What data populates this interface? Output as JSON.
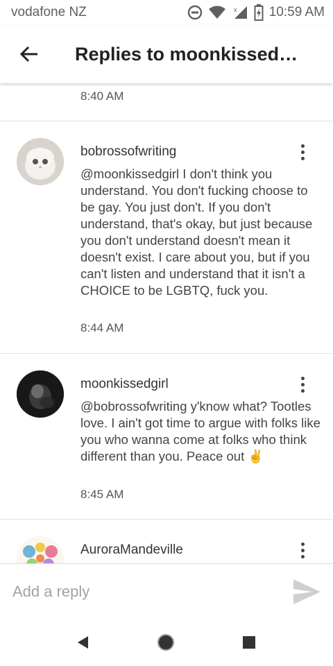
{
  "status_bar": {
    "carrier": "vodafone NZ",
    "time": "10:59 AM"
  },
  "header": {
    "title": "Replies to moonkissed…"
  },
  "previous_reply": {
    "time": "8:40 AM"
  },
  "replies": [
    {
      "username": "bobrossofwriting",
      "text": "@moonkissedgirl I don't think you understand. You don't fucking choose to be gay. You just don't. If you don't understand, that's okay, but just because you don't understand doesn't mean it doesn't exist. I care about you, but if you can't listen and understand that it isn't a CHOICE to be LGBTQ, fuck you.",
      "time": "8:44 AM"
    },
    {
      "username": "moonkissedgirl",
      "text": "@bobrossofwriting y'know what? Tootles love. I ain't got time to argue with folks like you who wanna come at folks who think different than you. Peace out ✌️",
      "time": "8:45 AM"
    },
    {
      "username": "AuroraMandeville"
    }
  ],
  "composer": {
    "placeholder": "Add a reply"
  },
  "icons": {
    "back": "arrow-back-icon",
    "more": "more-vert-icon",
    "send": "send-icon",
    "nav_back": "nav-back-icon",
    "nav_home": "nav-home-icon",
    "nav_recents": "nav-recents-icon"
  }
}
